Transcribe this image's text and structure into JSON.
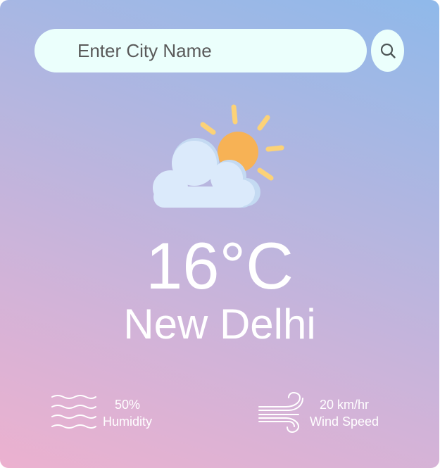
{
  "search": {
    "placeholder": "Enter City Name",
    "button_icon": "search-icon"
  },
  "weather": {
    "icon": "partly-cloudy-icon",
    "temperature": "16°C",
    "city": "New Delhi"
  },
  "details": {
    "humidity": {
      "icon": "humidity-waves-icon",
      "value": "50%",
      "label": "Humidity"
    },
    "wind": {
      "icon": "wind-icon",
      "value": "20 km/hr",
      "label": "Wind Speed"
    }
  },
  "colors": {
    "gradient_top_right": "#8fb9ea",
    "gradient_bottom_left": "#ecb1cf",
    "search_background": "#ebfffc",
    "sun": "#f7b255",
    "sun_rays": "#fcd277",
    "cloud": "#dbeafb",
    "text": "#ffffff"
  }
}
